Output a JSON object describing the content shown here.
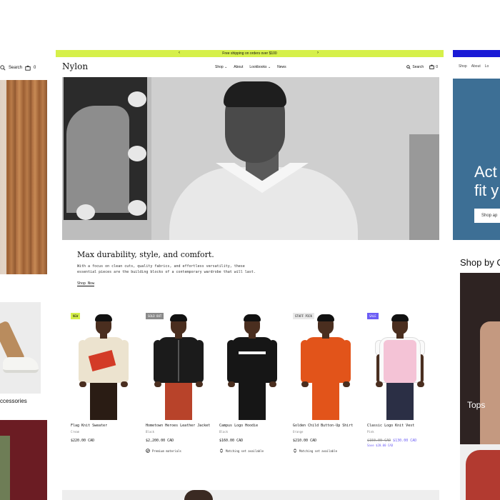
{
  "left": {
    "search_label": "Search",
    "cart_count": "0",
    "accessories_label": "ccessories"
  },
  "right": {
    "nav": [
      "Shop",
      "About",
      "Lo"
    ],
    "hero_text_1": "Act",
    "hero_text_2": "fit y",
    "hero_button": "Shop ap",
    "shop_by": "Shop by C",
    "tops_label": "Tops"
  },
  "promo": {
    "text": "Free shipping on orders over $100",
    "prev_icon": "chevron-left-icon",
    "next_icon": "chevron-right-icon"
  },
  "header": {
    "logo": "Nylon",
    "nav": [
      "Shop",
      "About",
      "Lookbooks",
      "News"
    ],
    "search_label": "Search",
    "cart_count": "0"
  },
  "hero": {
    "tagline": "Max durability, style, and comfort.",
    "description": "With a focus on clean cuts, quality fabrics, and effortless versatility, these essential pieces are the building blocks of a contemporary wardrobe that will last.",
    "cta": "Shop Now"
  },
  "products": [
    {
      "badge": "NEW",
      "badge_color": "#d6f04a",
      "name": "Flag Knit Sweater",
      "color": "Cream",
      "price": "$220.00 CAD",
      "feature": ""
    },
    {
      "badge": "SOLD OUT",
      "badge_color": "#8a8a8a",
      "name": "Hometown Heroes Leather Jacket",
      "color": "Black",
      "price": "$2,200.00 CAD",
      "feature": "Premium materials"
    },
    {
      "badge": "",
      "badge_color": "",
      "name": "Campus Logo Hoodie",
      "color": "Black",
      "price": "$160.00 CAD",
      "feature": "Matching set available"
    },
    {
      "badge": "STAFF PICK",
      "badge_color": "#e9e9e9",
      "name": "Golden Child Button-Up Shirt",
      "color": "Orange",
      "price": "$210.00 CAD",
      "feature": "Matching set available"
    },
    {
      "badge": "SALE",
      "badge_color": "#6b5cf5",
      "name": "Classic Logo Knit Vest",
      "color": "Pink",
      "price_old": "$150.00 CAD",
      "price_new": "$130.00 CAD",
      "save": "Save $20.00 CAD",
      "feature": ""
    }
  ]
}
